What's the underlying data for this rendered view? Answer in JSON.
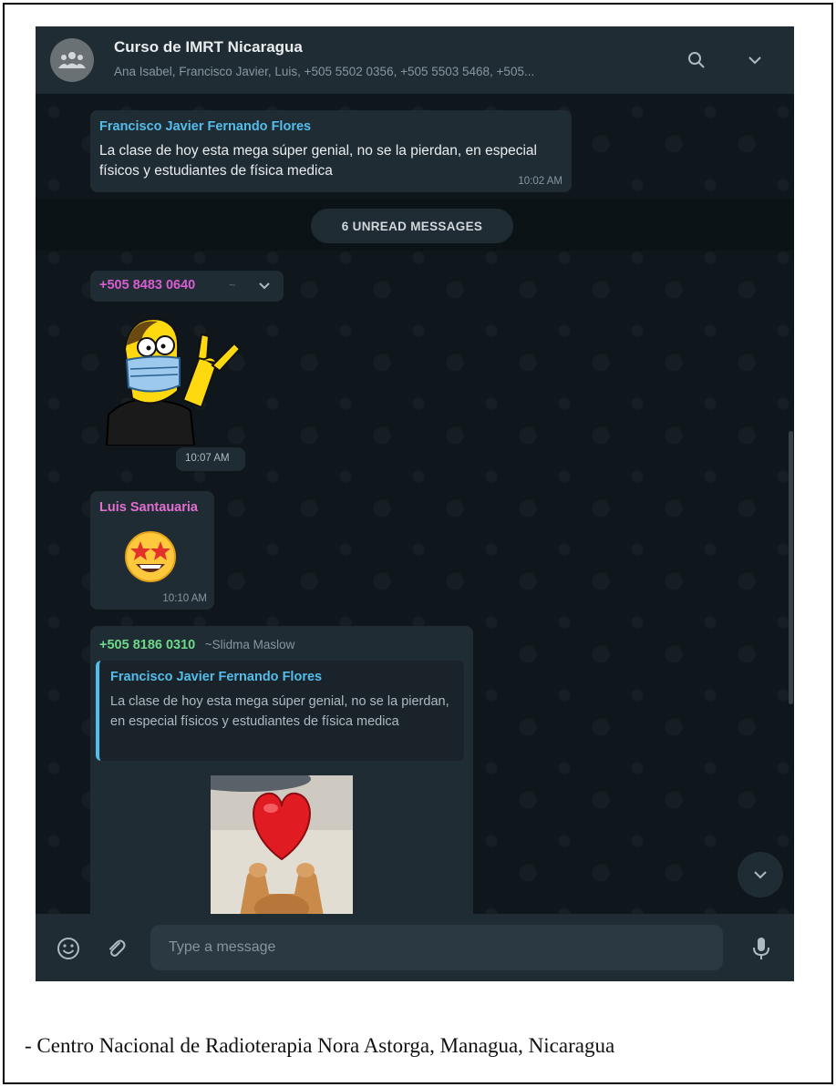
{
  "header": {
    "title": "Curso de IMRT Nicaragua",
    "members": "Ana Isabel, Francisco Javier, Luis, +505 5502 0356, +505 5503 5468, +505...",
    "avatar_icon": "group-icon",
    "search_icon": "search-icon",
    "menu_icon": "chevron-down-icon"
  },
  "messages": [
    {
      "sender": "Francisco Javier Fernando Flores",
      "sender_color": "#53bdeb",
      "text": "La clase de hoy esta mega súper genial, no se la pierdan, en especial físicos y estudiantes de física medica",
      "time": "10:02 AM"
    },
    {
      "sender": "+505 8483 0640",
      "sender_color": "#d85dd0",
      "sender_suffix": "~",
      "type": "sticker",
      "sticker": "masked-cartoon-rock-hand-sticker",
      "time": "10:07 AM"
    },
    {
      "sender": "Luis Santauaria",
      "sender_color": "#e06fd0",
      "type": "emoji",
      "emoji": "🤩",
      "time": "10:10 AM"
    },
    {
      "sender": "+505 8186 0310",
      "sender_color": "#6fd98a",
      "sender_alias": "~Slidma Maslow",
      "quote": {
        "author": "Francisco Javier Fernando Flores",
        "text": "La clase de hoy esta mega súper genial, no se la pierdan, en especial físicos y estudiantes de física medica"
      },
      "type": "image",
      "image": "heart-and-cat-image"
    }
  ],
  "unread_label": "6 UNREAD MESSAGES",
  "composer": {
    "placeholder": "Type a message",
    "emoji_icon": "emoji-icon",
    "attach_icon": "paperclip-icon",
    "mic_icon": "microphone-icon"
  },
  "scroll_button_icon": "chevron-down-icon",
  "caption": "- Centro Nacional de Radioterapia Nora Astorga, Managua, Nicaragua",
  "colors": {
    "header_bg": "#202c33",
    "chat_bg": "#0b141a",
    "bubble_bg": "#202c33",
    "quote_bar": "#53bdeb"
  }
}
